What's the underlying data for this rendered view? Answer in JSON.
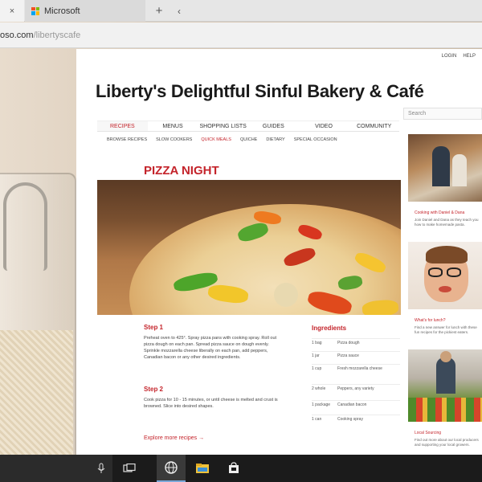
{
  "browser": {
    "tabs": [
      {
        "label": "",
        "close_glyph": "×"
      },
      {
        "label": "Microsoft"
      }
    ],
    "new_tab_glyph": "+",
    "tab_list_glyph": "‹",
    "address": {
      "host": "oso.com",
      "path": "/libertyscafe"
    }
  },
  "site": {
    "top_links": [
      "LOGIN",
      "HELP"
    ],
    "title": "Liberty's Delightful Sinful Bakery & Café",
    "search_placeholder": "Search",
    "nav": [
      "RECIPES",
      "MENUS",
      "SHOPPING LISTS",
      "GUIDES",
      "VIDEO",
      "COMMUNITY"
    ],
    "nav_active": 0,
    "subnav": [
      "BROWSE RECIPES",
      "SLOW COOKERS",
      "QUICK MEALS",
      "QUICHE",
      "DIETARY",
      "SPECIAL OCCASION"
    ],
    "subnav_active": 2
  },
  "recipe": {
    "title": "PIZZA NIGHT",
    "step1_heading": "Step 1",
    "step1_text": "Preheat oven to 425°. Spray pizza pans with cooking spray. Roll out pizza dough on each pan. Spread pizza sauce on dough evenly. Sprinkle mozzarella cheese liberally on each pan, add peppers, Canadian bacon or any other desired ingredients.",
    "step2_heading": "Step 2",
    "step2_text": "Cook pizza for 10 - 15 minutes, or until cheese is melted and crust is browned. Slice into desired shapes.",
    "explore_link": "Explore more recipes →",
    "ingredients_heading": "Ingredients",
    "ingredients": [
      {
        "qty": "1 bag",
        "name": "Pizza dough"
      },
      {
        "qty": "1 jar",
        "name": "Pizza sauce"
      },
      {
        "qty": "1 cup",
        "name": "Fresh mozzarella cheese"
      },
      {
        "qty": "2 whole",
        "name": "Peppers, any variety"
      },
      {
        "qty": "1 package",
        "name": "Canadian bacon"
      },
      {
        "qty": "1 can",
        "name": "Cooking spray"
      }
    ]
  },
  "sidebar": {
    "items": [
      {
        "caption": "Cooking with Daniel & Dana",
        "text": "Join Daniel and Dana as they teach you how to make homemade pasta."
      },
      {
        "caption": "What's for lunch?",
        "text": "Find a new answer for lunch with these fun recipes for the pickiest eaters."
      },
      {
        "caption": "Local Sourcing",
        "text": "Find out more about our local producers and supporting your local growers."
      }
    ]
  },
  "taskbar": {
    "icons": [
      "microphone-icon",
      "task-view-icon",
      "edge-browser-icon",
      "file-explorer-icon",
      "store-icon"
    ],
    "active": 2
  },
  "colors": {
    "accent": "#c4242b",
    "taskbar": "#1b1b1b"
  }
}
